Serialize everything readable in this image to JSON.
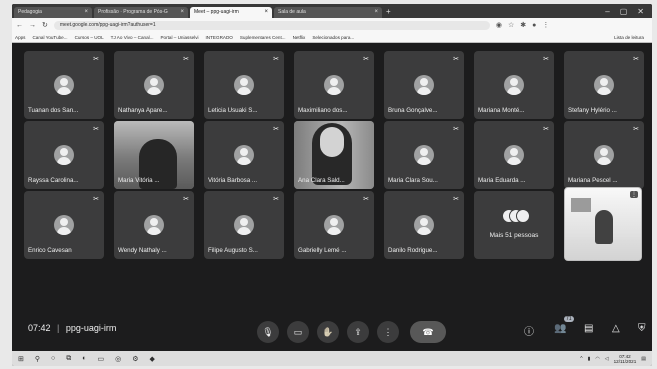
{
  "browser": {
    "tabs": [
      {
        "label": "Pedagogia",
        "active": false
      },
      {
        "label": "Profissão · Programa de Pós-G",
        "active": false
      },
      {
        "label": "Meet – ppg-uagi-irm",
        "active": true
      },
      {
        "label": "Sala de aula",
        "active": false
      }
    ],
    "new_tab": "+",
    "address": "meet.google.com/ppg-uagi-irm?authuser=1",
    "bookmarks": [
      "Apps",
      "Canal YouTube...",
      "Cursos – UOL",
      "TJ Ao Vivo – Canal...",
      "Portal – Uniasselvi",
      "INTEGRADO",
      "Suplementares Cent...",
      "Netflix",
      "Selecionados para...",
      "Lista de leitura"
    ]
  },
  "meet": {
    "participants": [
      {
        "name": "Tuanan dos San...",
        "kind": "avatar"
      },
      {
        "name": "Nathanya Apare...",
        "kind": "avatar"
      },
      {
        "name": "Leticia Usuaki S...",
        "kind": "avatar"
      },
      {
        "name": "Maximiliano dos...",
        "kind": "avatar"
      },
      {
        "name": "Bruna Gonçalve...",
        "kind": "avatar"
      },
      {
        "name": "Mariana Monté...",
        "kind": "avatar"
      },
      {
        "name": "Stefany Hylério ...",
        "kind": "avatar"
      },
      {
        "name": "Rayssa Carolina...",
        "kind": "avatar"
      },
      {
        "name": "Maria Vitória ...",
        "kind": "video"
      },
      {
        "name": "Vitória Barbosa ...",
        "kind": "avatar"
      },
      {
        "name": "Ana Clara Sald...",
        "kind": "video"
      },
      {
        "name": "Maria Clara Sou...",
        "kind": "avatar"
      },
      {
        "name": "Maria Eduarda ...",
        "kind": "avatar"
      },
      {
        "name": "Mariana Pescel ...",
        "kind": "avatar"
      },
      {
        "name": "Enrico Cavesan",
        "kind": "avatar"
      },
      {
        "name": "Wendy Nathaly ...",
        "kind": "avatar"
      },
      {
        "name": "Filipe Augusto S...",
        "kind": "avatar"
      },
      {
        "name": "Gabrielly Lemé ...",
        "kind": "avatar"
      },
      {
        "name": "Danilo Rodrigue...",
        "kind": "avatar"
      }
    ],
    "more_label": "Mais 51 pessoas",
    "time": "07:42",
    "separator": "|",
    "meeting_code": "ppg-uagi-irm",
    "participants_badge": "71"
  },
  "taskbar": {
    "clock_time": "07:42",
    "clock_date": "12/11/2021"
  },
  "icons": {
    "mic": "mic-icon",
    "camera": "camera-icon",
    "hand": "raise-hand-icon",
    "present": "present-icon",
    "more": "more-vert-icon",
    "hangup": "call-end-icon",
    "info": "info-icon",
    "people": "people-icon",
    "chat": "chat-icon",
    "activities": "activities-icon",
    "security": "shield-icon"
  }
}
